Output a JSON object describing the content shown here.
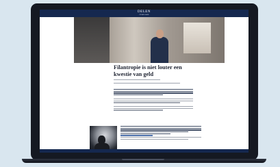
{
  "header": {
    "brand": "DELEN",
    "brand_sub": "PRIVATE BANK"
  },
  "article": {
    "title": "Filantropie is niet louter een kwestie van geld"
  }
}
